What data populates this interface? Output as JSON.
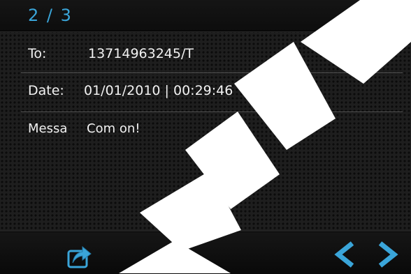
{
  "header": {
    "page_indicator": "2 / 3"
  },
  "message": {
    "to_label": "To:",
    "to_value": "13714963245/T",
    "date_label": "Date:",
    "date_value": "01/01/2010 | 00:29:46",
    "message_label": "Messa",
    "message_value": "Com on!"
  },
  "colors": {
    "accent": "#3aa5d9",
    "watermark": "#ffffff"
  },
  "icons": {
    "back": "return-arrow-icon",
    "forward": "share-forward-icon",
    "previous": "chevron-left-icon",
    "next": "chevron-right-icon"
  }
}
